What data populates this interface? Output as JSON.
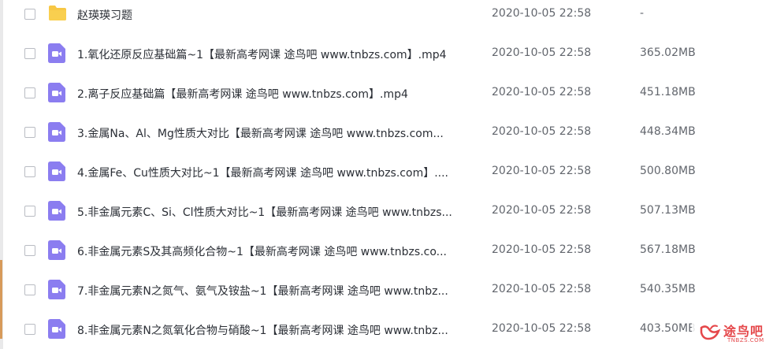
{
  "files": [
    {
      "icon": "folder-icon",
      "name": "赵瑛瑛习题",
      "date": "2020-10-05 22:58",
      "size": "-"
    },
    {
      "icon": "video-file-icon",
      "name": "1.氧化还原反应基础篇~1【最新高考网课 途鸟吧 www.tnbzs.com】.mp4",
      "date": "2020-10-05 22:58",
      "size": "365.02MB"
    },
    {
      "icon": "video-file-icon",
      "name": "2.离子反应基础篇【最新高考网课 途鸟吧 www.tnbzs.com】.mp4",
      "date": "2020-10-05 22:58",
      "size": "451.18MB"
    },
    {
      "icon": "video-file-icon",
      "name": "3.金属Na、Al、Mg性质大对比【最新高考网课 途鸟吧 www.tnbzs.com...",
      "date": "2020-10-05 22:58",
      "size": "448.34MB"
    },
    {
      "icon": "video-file-icon",
      "name": "4.金属Fe、Cu性质大对比~1【最新高考网课 途鸟吧 www.tnbzs.com】....",
      "date": "2020-10-05 22:58",
      "size": "500.80MB"
    },
    {
      "icon": "video-file-icon",
      "name": "5.非金属元素C、Si、Cl性质大对比~1【最新高考网课 途鸟吧 www.tnbzs...",
      "date": "2020-10-05 22:58",
      "size": "507.13MB"
    },
    {
      "icon": "video-file-icon",
      "name": "6.非金属元素S及其高频化合物~1【最新高考网课 途鸟吧 www.tnbzs.co...",
      "date": "2020-10-05 22:58",
      "size": "567.18MB"
    },
    {
      "icon": "video-file-icon",
      "name": "7.非金属元素N之氮气、氨气及铵盐~1【最新高考网课 途鸟吧 www.tnbz...",
      "date": "2020-10-05 22:58",
      "size": "540.35MB"
    },
    {
      "icon": "video-file-icon",
      "name": "8.非金属元素N之氮氧化合物与硝酸~1【最新高考网课 途鸟吧 www.tnbz...",
      "date": "2020-10-05 22:58",
      "size": "403.50MB"
    }
  ],
  "watermark": {
    "cn": "途鸟吧",
    "en": "TNBZS.COM"
  },
  "colors": {
    "folder": "#f7c744",
    "video": "#8b7df0",
    "watermark": "#e5474a"
  }
}
